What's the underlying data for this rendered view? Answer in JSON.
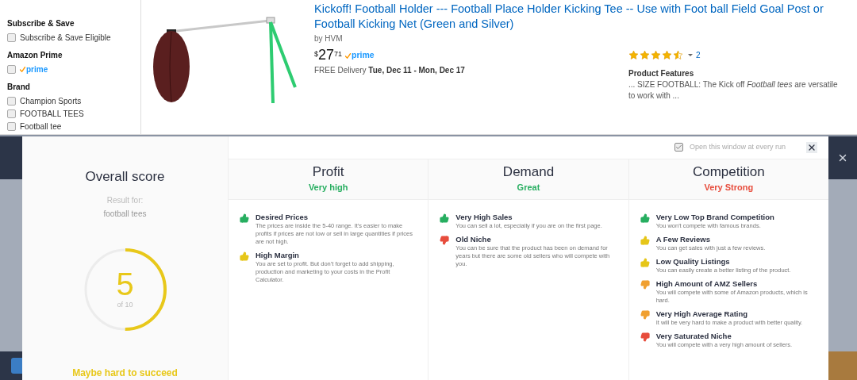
{
  "sidebar": {
    "sections": [
      {
        "title": "Subscribe & Save",
        "options": [
          {
            "kind": "text",
            "label": "Subscribe & Save Eligible",
            "checked": false
          }
        ]
      },
      {
        "title": "Amazon Prime",
        "options": [
          {
            "kind": "prime",
            "label": "prime",
            "checked": false
          }
        ]
      },
      {
        "title": "Brand",
        "options": [
          {
            "kind": "text",
            "label": "Champion Sports",
            "checked": false
          },
          {
            "kind": "text",
            "label": "FOOTBALL TEES",
            "checked": false
          },
          {
            "kind": "text",
            "label": "Football tee",
            "checked": false
          }
        ]
      }
    ]
  },
  "product": {
    "title": "Kickoff! Football Holder --- Football Place Holder Kicking Tee -- Use with Foot ball Field Goal Post or Football Kicking Net (Green and Silver)",
    "byline": "by HVM",
    "price_symbol": "$",
    "price_whole": "27",
    "price_fraction": "71",
    "prime_label": "prime",
    "delivery_label": "FREE Delivery",
    "delivery_dates": "Tue, Dec 11 - Mon, Dec 17",
    "stars": 4.5,
    "review_count": "2",
    "features_title": "Product Features",
    "features_text": "... SIZE FOOTBALL: The Kick off *Football tees* are versatile to work with ..."
  },
  "modal": {
    "open_every_run": {
      "label": "Open this window at every run",
      "checked": true
    },
    "overall": {
      "title": "Overall score",
      "result_label": "Result for:",
      "keyword": "football tees",
      "score": "5",
      "score_of": "of 10",
      "level": 0.5,
      "verdict": "Maybe hard to succeed"
    },
    "columns": [
      {
        "title": "Profit",
        "rating": "Very high",
        "color": "#27ae60",
        "items": [
          {
            "kind": "up",
            "color": "#27ae60",
            "title": "Desired Prices",
            "text": "The prices are inside the 5-40 range. It's easier to make profits if prices are not low or sell in large quantities if prices are not high."
          },
          {
            "kind": "up",
            "color": "#e6c619",
            "title": "High Margin",
            "text": "You are set to profit. But don't forget to add shipping, production and marketing to your costs in the Profit Calculator."
          }
        ]
      },
      {
        "title": "Demand",
        "rating": "Great",
        "color": "#27ae60",
        "items": [
          {
            "kind": "up",
            "color": "#27ae60",
            "title": "Very High Sales",
            "text": "You can sell a lot, especially if you are on the first page."
          },
          {
            "kind": "down",
            "color": "#e74c3c",
            "title": "Old Niche",
            "text": "You can be sure that the product has been on demand for years but there are some old sellers who will compete with you."
          }
        ]
      },
      {
        "title": "Competition",
        "rating": "Very Strong",
        "color": "#e74c3c",
        "items": [
          {
            "kind": "up",
            "color": "#27ae60",
            "title": "Very Low Top Brand Competition",
            "text": "You won't compete with famous brands."
          },
          {
            "kind": "up",
            "color": "#e6c619",
            "title": "A Few Reviews",
            "text": "You can get sales with just a few reviews."
          },
          {
            "kind": "up",
            "color": "#e6c619",
            "title": "Low Quality Listings",
            "text": "You can easily create a better listing of the product."
          },
          {
            "kind": "down",
            "color": "#f0a030",
            "title": "High Amount of AMZ Sellers",
            "text": "You will compete with some of Amazon products, which is hard."
          },
          {
            "kind": "down",
            "color": "#f0a030",
            "title": "Very High Average Rating",
            "text": "It will be very hard to make a product with better quality."
          },
          {
            "kind": "down",
            "color": "#e74c3c",
            "title": "Very Saturated Niche",
            "text": "You will compete with a very high amount of sellers."
          }
        ]
      }
    ]
  }
}
